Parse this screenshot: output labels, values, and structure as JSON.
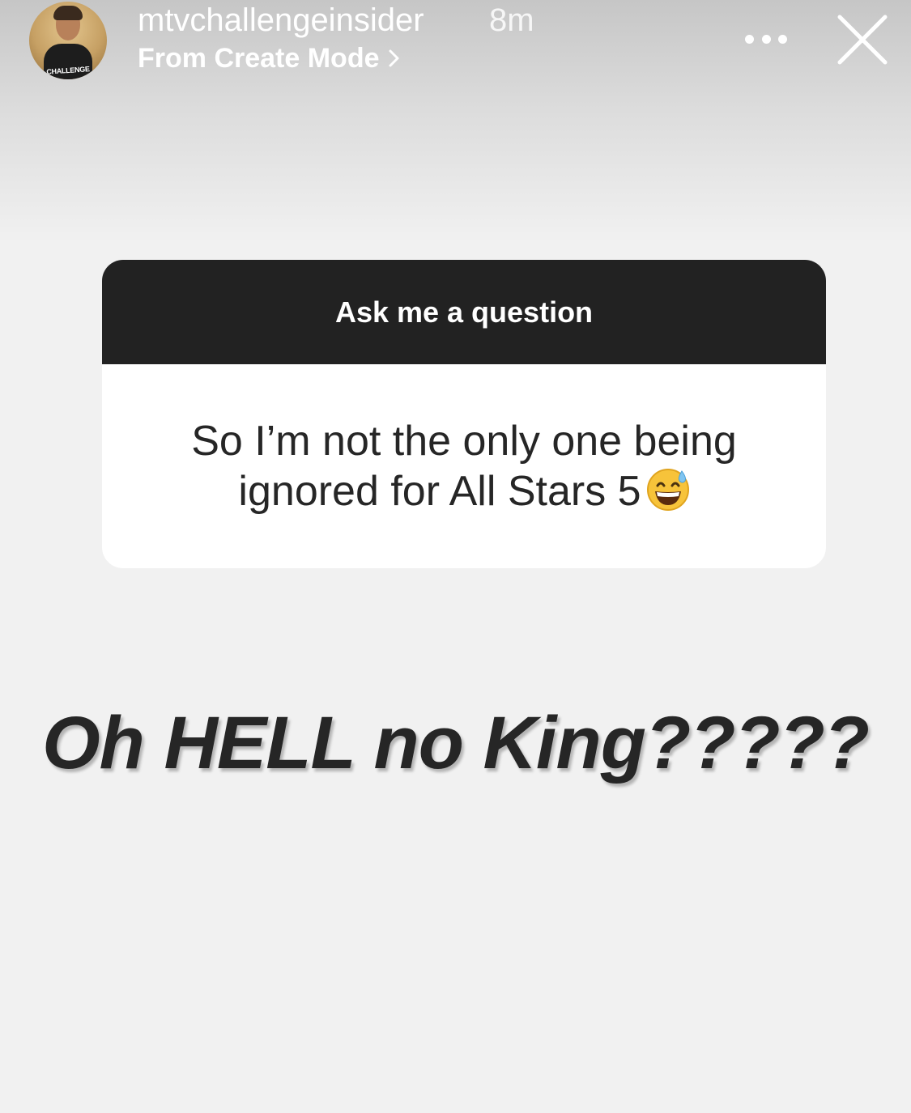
{
  "header": {
    "username": "mtvchallengeinsider",
    "time": "8m",
    "subtitle": "From Create Mode",
    "avatar_text": "CHALLENGE"
  },
  "sticker": {
    "title": "Ask me a question",
    "question": "So I’m not the only one being ignored for All Stars 5",
    "emoji": "grinning-face-with-sweat-icon"
  },
  "caption": "Oh HELL no King?????",
  "icons": {
    "more": "more-options-icon",
    "close": "close-icon",
    "chevron": "chevron-right-icon"
  },
  "colors": {
    "background": "#f1f1f1",
    "card_header": "#222222",
    "text_dark": "#262626"
  }
}
